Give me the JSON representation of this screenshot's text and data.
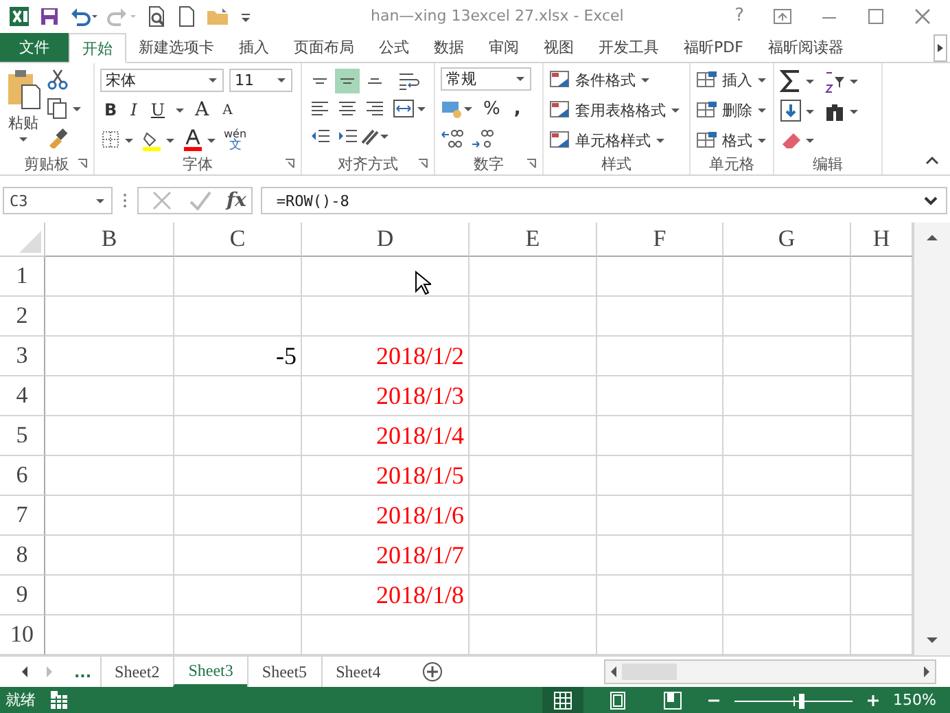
{
  "title_bar": {
    "title": "han—xing 13excel 27.xlsx - Excel",
    "help": "?"
  },
  "tabs": [
    {
      "label": "文件",
      "kind": "file",
      "selected": false
    },
    {
      "label": "开始",
      "kind": "tab",
      "selected": true
    },
    {
      "label": "新建选项卡",
      "kind": "tab",
      "selected": false
    },
    {
      "label": "插入",
      "kind": "tab",
      "selected": false
    },
    {
      "label": "页面布局",
      "kind": "tab",
      "selected": false
    },
    {
      "label": "公式",
      "kind": "tab",
      "selected": false
    },
    {
      "label": "数据",
      "kind": "tab",
      "selected": false
    },
    {
      "label": "审阅",
      "kind": "tab",
      "selected": false
    },
    {
      "label": "视图",
      "kind": "tab",
      "selected": false
    },
    {
      "label": "开发工具",
      "kind": "tab",
      "selected": false
    },
    {
      "label": "福昕PDF",
      "kind": "tab",
      "selected": false
    },
    {
      "label": "福昕阅读器",
      "kind": "tab",
      "selected": false
    }
  ],
  "ribbon": {
    "clipboard": {
      "label": "剪贴板",
      "paste": "粘贴"
    },
    "font": {
      "label": "字体",
      "font_name": "宋体",
      "font_size": "11",
      "bold": "B",
      "italic": "I",
      "underline": "U",
      "grow": "A",
      "shrink": "A",
      "phonetic": "wén",
      "phonetic_char": "文"
    },
    "alignment": {
      "label": "对齐方式",
      "buttons": [
        {
          "kind": "top",
          "selected": false
        },
        {
          "kind": "middle",
          "selected": true
        },
        {
          "kind": "bottom",
          "selected": false
        },
        {
          "kind": "wrap",
          "selected": false
        },
        {
          "kind": "left",
          "selected": false
        },
        {
          "kind": "center",
          "selected": false
        },
        {
          "kind": "right",
          "selected": false
        },
        {
          "kind": "merge",
          "selected": false
        },
        {
          "kind": "outdent",
          "selected": false
        },
        {
          "kind": "indent",
          "selected": false
        },
        {
          "kind": "orientation",
          "selected": false
        }
      ]
    },
    "number": {
      "label": "数字",
      "format": "常规",
      "percent": "%",
      "comma": ","
    },
    "styles": {
      "label": "样式",
      "items": [
        "条件格式",
        "套用表格格式",
        "单元格样式"
      ]
    },
    "cells": {
      "label": "单元格",
      "items": [
        "插入",
        "删除",
        "格式"
      ]
    },
    "editing": {
      "label": "编辑"
    }
  },
  "formula_bar": {
    "name_box": "C3",
    "formula": "=ROW()-8",
    "fx": "fx"
  },
  "columns": [
    "B",
    "C",
    "D",
    "E",
    "F",
    "G",
    "H"
  ],
  "rows": [
    {
      "header": "1",
      "cells": {}
    },
    {
      "header": "2",
      "cells": {}
    },
    {
      "header": "3",
      "cells": {
        "C": {
          "text": "-5",
          "color": "#000000"
        },
        "D": {
          "text": "2018/1/2",
          "color": "#ff0000"
        }
      }
    },
    {
      "header": "4",
      "cells": {
        "D": {
          "text": "2018/1/3",
          "color": "#ff0000"
        }
      }
    },
    {
      "header": "5",
      "cells": {
        "D": {
          "text": "2018/1/4",
          "color": "#ff0000"
        }
      }
    },
    {
      "header": "6",
      "cells": {
        "D": {
          "text": "2018/1/5",
          "color": "#ff0000"
        }
      }
    },
    {
      "header": "7",
      "cells": {
        "D": {
          "text": "2018/1/6",
          "color": "#ff0000"
        }
      }
    },
    {
      "header": "8",
      "cells": {
        "D": {
          "text": "2018/1/7",
          "color": "#ff0000"
        }
      }
    },
    {
      "header": "9",
      "cells": {
        "D": {
          "text": "2018/1/8",
          "color": "#ff0000"
        }
      }
    },
    {
      "header": "10",
      "cells": {}
    }
  ],
  "sheet_tabs": {
    "more": "...",
    "tabs": [
      {
        "label": "Sheet2",
        "selected": false
      },
      {
        "label": "Sheet3",
        "selected": true
      },
      {
        "label": "Sheet5",
        "selected": false
      },
      {
        "label": "Sheet4",
        "selected": false
      }
    ]
  },
  "status_bar": {
    "status": "就绪",
    "zoom": "150%",
    "level": 0.58
  }
}
